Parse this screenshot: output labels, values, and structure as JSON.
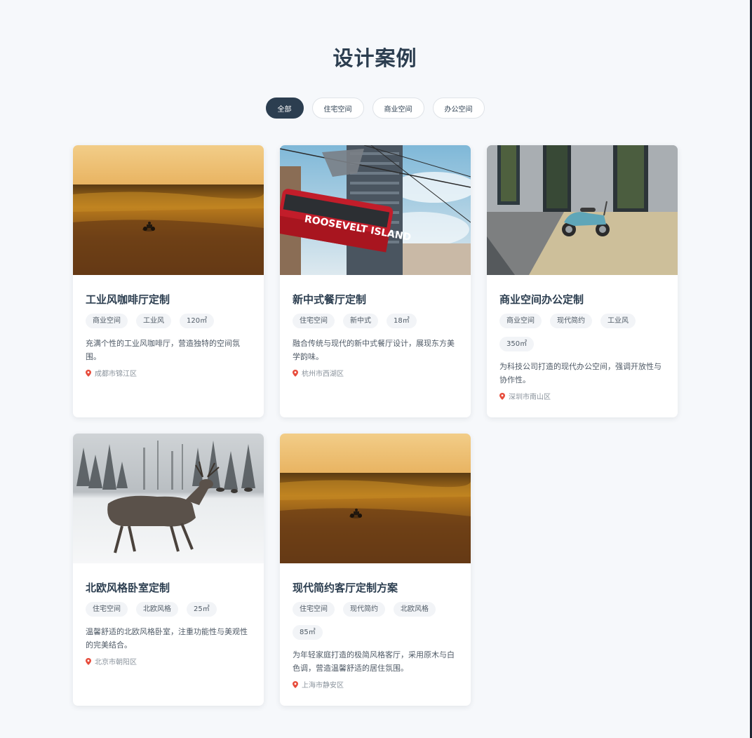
{
  "page_title": "设计案例",
  "filters": [
    {
      "label": "全部",
      "active": true
    },
    {
      "label": "住宅空间",
      "active": false
    },
    {
      "label": "商业空间",
      "active": false
    },
    {
      "label": "办公空间",
      "active": false
    }
  ],
  "colors": {
    "primary": "#2c3e50",
    "pin": "#e74c3c",
    "background": "#f6f8fb"
  },
  "cases": [
    {
      "image": "desert-rider-photo",
      "title": "工业风咖啡厅定制",
      "tags": [
        "商业空间",
        "工业风",
        "120㎡"
      ],
      "description": "充满个性的工业风咖啡厅，营造独特的空间氛围。",
      "location": "成都市锦江区"
    },
    {
      "image": "roosevelt-island-tram-photo",
      "image_text": "ROOSEVELT ISLAND",
      "title": "新中式餐厅定制",
      "tags": [
        "住宅空间",
        "新中式",
        "18㎡"
      ],
      "description": "融合传统与现代的新中式餐厅设计，展现东方美学韵味。",
      "location": "杭州市西湖区"
    },
    {
      "image": "scooter-building-photo",
      "title": "商业空间办公定制",
      "tags": [
        "商业空间",
        "现代简约",
        "工业风",
        "350㎡"
      ],
      "description": "为科技公司打造的现代办公空间，强调开放性与协作性。",
      "location": "深圳市南山区"
    },
    {
      "image": "deer-snow-photo",
      "title": "北欧风格卧室定制",
      "tags": [
        "住宅空间",
        "北欧风格",
        "25㎡"
      ],
      "description": "温馨舒适的北欧风格卧室，注重功能性与美观性的完美结合。",
      "location": "北京市朝阳区"
    },
    {
      "image": "desert-rider-photo",
      "title": "现代简约客厅定制方案",
      "tags": [
        "住宅空间",
        "现代简约",
        "北欧风格",
        "85㎡"
      ],
      "description": "为年轻家庭打造的极简风格客厅，采用原木与白色调，营造温馨舒适的居住氛围。",
      "location": "上海市静安区"
    }
  ]
}
